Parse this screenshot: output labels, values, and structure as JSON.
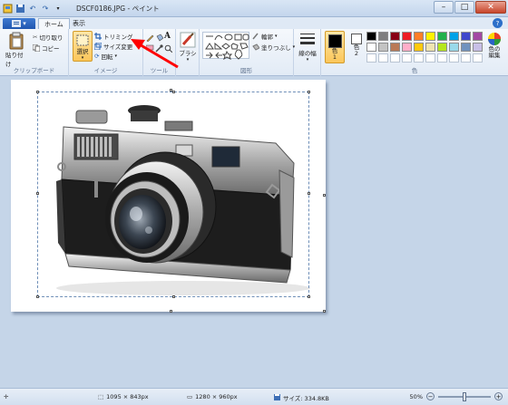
{
  "window": {
    "title": "DSCF0186.JPG - ペイント",
    "minimize": "–",
    "maximize": "□",
    "close": "✕"
  },
  "tabs": {
    "file": "▾",
    "home": "ホーム",
    "view": "表示",
    "help": "?"
  },
  "clipboard": {
    "paste": "貼り付け",
    "cut": "切り取り",
    "copy": "コピー",
    "label": "クリップボード"
  },
  "image": {
    "select": "選択",
    "crop": "トリミング",
    "resize": "サイズ変更",
    "rotate": "回転",
    "label": "イメージ"
  },
  "tools": {
    "label": "ツール",
    "text_glyph": "A"
  },
  "brushes": {
    "label": "ブラシ"
  },
  "shapes": {
    "outline": "輪郭",
    "fill": "塗りつぶし",
    "label": "図形"
  },
  "size": {
    "label": "線の幅"
  },
  "color": {
    "color1": "色\n1",
    "color2": "色\n2",
    "edit": "色の\n編集",
    "label": "色",
    "color1_value": "#000000",
    "color2_value": "#ffffff",
    "palette": [
      "#000000",
      "#7f7f7f",
      "#880015",
      "#ed1c24",
      "#ff7f27",
      "#fff200",
      "#22b14c",
      "#00a2e8",
      "#3f48cc",
      "#a349a4",
      "#ffffff",
      "#c3c3c3",
      "#b97a57",
      "#ffaec9",
      "#ffc90e",
      "#efe4b0",
      "#b5e61d",
      "#99d9ea",
      "#7092be",
      "#c8bfe7",
      "",
      "",
      "",
      "",
      "",
      "",
      "",
      "",
      "",
      ""
    ]
  },
  "status": {
    "selection_size": "1095 × 843px",
    "image_size": "1280 × 960px",
    "file_size": "サイズ: 334.8KB",
    "zoom": "50%",
    "zoom_fraction": 0.5
  },
  "colors": {
    "accent": "#ff0000",
    "ribbon": "#e2ebf6",
    "canvas_bg": "#c5d5e8"
  }
}
